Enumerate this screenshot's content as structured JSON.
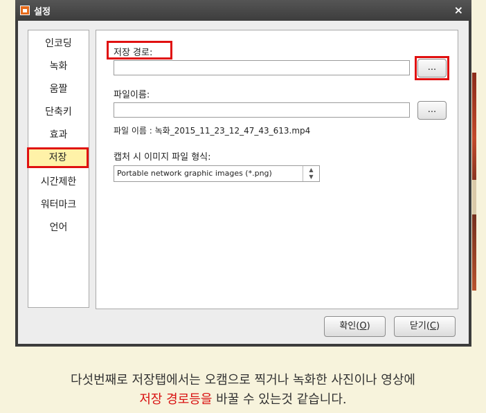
{
  "window": {
    "title": "설정",
    "close_label": "×"
  },
  "sidebar": {
    "items": [
      {
        "label": "인코딩"
      },
      {
        "label": "녹화"
      },
      {
        "label": "움짤"
      },
      {
        "label": "단축키"
      },
      {
        "label": "효과"
      },
      {
        "label": "저장",
        "selected": true
      },
      {
        "label": "시간제한"
      },
      {
        "label": "워터마크"
      },
      {
        "label": "언어"
      }
    ]
  },
  "panel": {
    "save_path_label": "저장 경로:",
    "save_path_value": "",
    "browse_label": "...",
    "filename_label": "파일이름:",
    "filename_value": "",
    "filename_preview": "파일 이름 : 녹화_2015_11_23_12_47_43_613.mp4",
    "capture_format_label": "캡처 시 이미지 파일 형식:",
    "capture_format_value": "Portable network graphic images (*.png)"
  },
  "buttons": {
    "ok": "확인(",
    "ok_key": "O",
    "close": "닫기(",
    "close_key": "C",
    "end": ")"
  },
  "caption": {
    "line1": "다섯번째로 저장탭에서는  오캠으로 찍거나 녹화한 사진이나 영상에",
    "line2_red": "저장 경로등을",
    "line2_rest": " 바꿀 수 있는것 같습니다."
  },
  "colors": {
    "highlight_border": "#e01010",
    "selected_fill": "#fff2a8",
    "title_bar": "#3d3d3d"
  }
}
